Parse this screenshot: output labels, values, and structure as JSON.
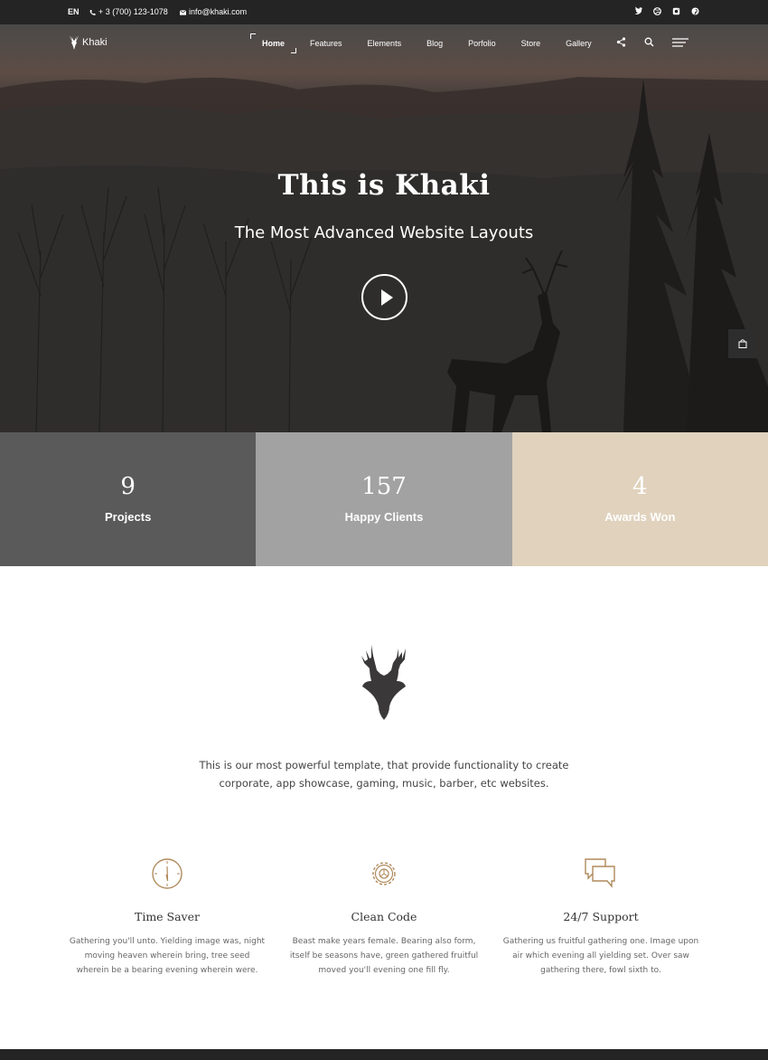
{
  "topbar": {
    "lang": "EN",
    "phone": "+ 3 (700) 123-1078",
    "email": "info@khaki.com",
    "socials": [
      "twitter-icon",
      "dribbble-icon",
      "instagram-icon",
      "pinterest-icon"
    ]
  },
  "header": {
    "logo_text": "Khaki",
    "nav": [
      {
        "label": "Home",
        "active": true
      },
      {
        "label": "Features"
      },
      {
        "label": "Elements"
      },
      {
        "label": "Blog"
      },
      {
        "label": "Porfolio"
      },
      {
        "label": "Store"
      },
      {
        "label": "Gallery"
      }
    ],
    "icons": [
      "share-icon",
      "search-icon",
      "menu-icon"
    ]
  },
  "hero": {
    "title": "This is Khaki",
    "subtitle": "The Most Advanced Website Layouts"
  },
  "stats": [
    {
      "value": "9",
      "label": "Projects",
      "color": "#5a5a5a"
    },
    {
      "value": "157",
      "label": "Happy Clients",
      "color": "#a2a2a2"
    },
    {
      "value": "4",
      "label": "Awards Won",
      "color": "#e0d2bd"
    }
  ],
  "intro": {
    "text": "This is our most powerful template, that provide functionality to create corporate, app showcase, gaming, music, barber, etc websites."
  },
  "features": [
    {
      "icon": "clock-icon",
      "title": "Time Saver",
      "text": "Gathering you'll unto. Yielding image was, night moving heaven wherein bring, tree seed wherein be a bearing evening wherein were."
    },
    {
      "icon": "gear-icon",
      "title": "Clean Code",
      "text": "Beast make years female. Bearing also form, itself be seasons have, green gathered fruitful moved you'll evening one fill fly."
    },
    {
      "icon": "chat-bubbles-icon",
      "title": "24/7 Support",
      "text": "Gathering us fruitful gathering one. Image upon air which evening all yielding set. Over saw gathering there, fowl sixth to."
    }
  ],
  "colors": {
    "accent": "#b08a5c",
    "dark": "#242424"
  }
}
